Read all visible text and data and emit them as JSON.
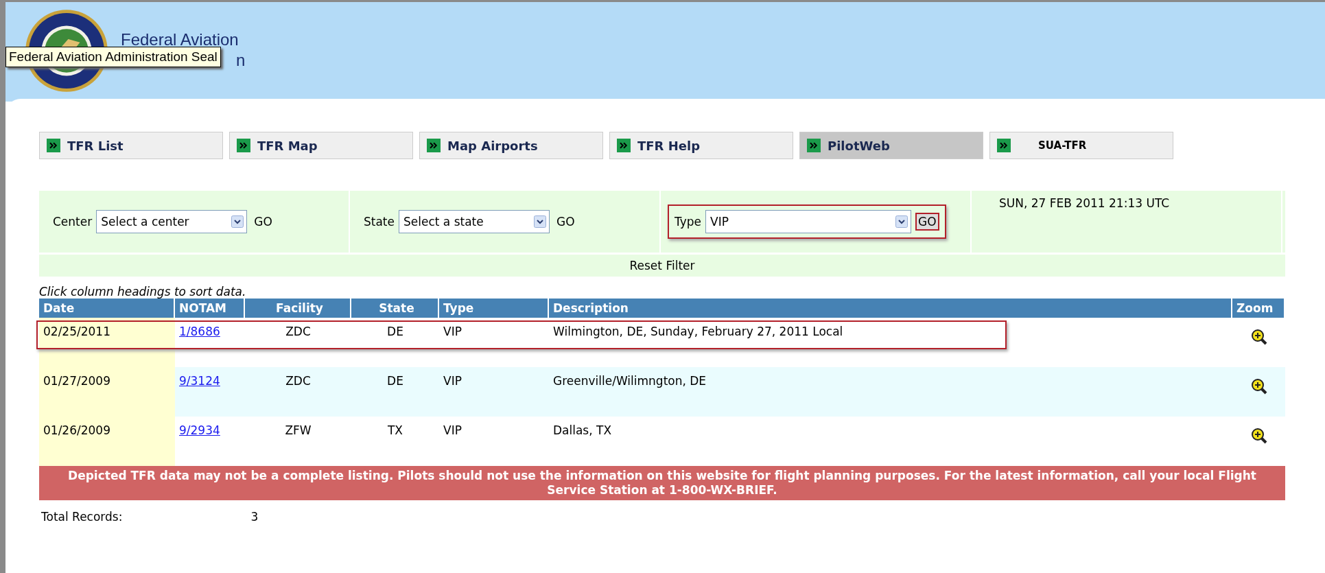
{
  "header": {
    "title_line_1": "Federal Aviation",
    "title_line_2_visible": "n",
    "tooltip": "Federal Aviation Administration Seal"
  },
  "tabs": [
    {
      "label": "TFR List",
      "selected": false
    },
    {
      "label": "TFR Map",
      "selected": false
    },
    {
      "label": "Map Airports",
      "selected": false
    },
    {
      "label": "TFR Help",
      "selected": false
    },
    {
      "label": "PilotWeb",
      "selected": true
    },
    {
      "label": "SUA-TFR",
      "selected": false
    }
  ],
  "filters": [
    {
      "label": "Center",
      "value": "Select a center",
      "go": "GO",
      "highlighted": false
    },
    {
      "label": "State",
      "value": "Select a state",
      "go": "GO",
      "highlighted": false
    },
    {
      "label": "Type",
      "value": "VIP",
      "go": "GO",
      "highlighted": true
    }
  ],
  "timestamp": "SUN, 27 FEB 2011 21:13 UTC",
  "reset_filter": "Reset Filter",
  "hint": "Click column headings to sort data.",
  "table": {
    "columns": [
      "Date",
      "NOTAM",
      "Facility",
      "State",
      "Type",
      "Description",
      "Zoom"
    ],
    "rows": [
      {
        "date": "02/25/2011",
        "notam": "1/8686",
        "facility": "ZDC",
        "state": "DE",
        "type": "VIP",
        "description": "Wilmington, DE, Sunday, February 27, 2011 Local",
        "highlighted": true
      },
      {
        "date": "01/27/2009",
        "notam": "9/3124",
        "facility": "ZDC",
        "state": "DE",
        "type": "VIP",
        "description": "Greenville/Wilimngton, DE",
        "highlighted": false
      },
      {
        "date": "01/26/2009",
        "notam": "9/2934",
        "facility": "ZFW",
        "state": "TX",
        "type": "VIP",
        "description": "Dallas, TX",
        "highlighted": false
      }
    ]
  },
  "warning": "Depicted TFR data may not be a complete listing. Pilots should not use the information on this website for flight planning purposes. For the latest information, call your local Flight Service Station at 1-800-WX-BRIEF.",
  "total": {
    "label": "Total Records:",
    "value": "3"
  }
}
